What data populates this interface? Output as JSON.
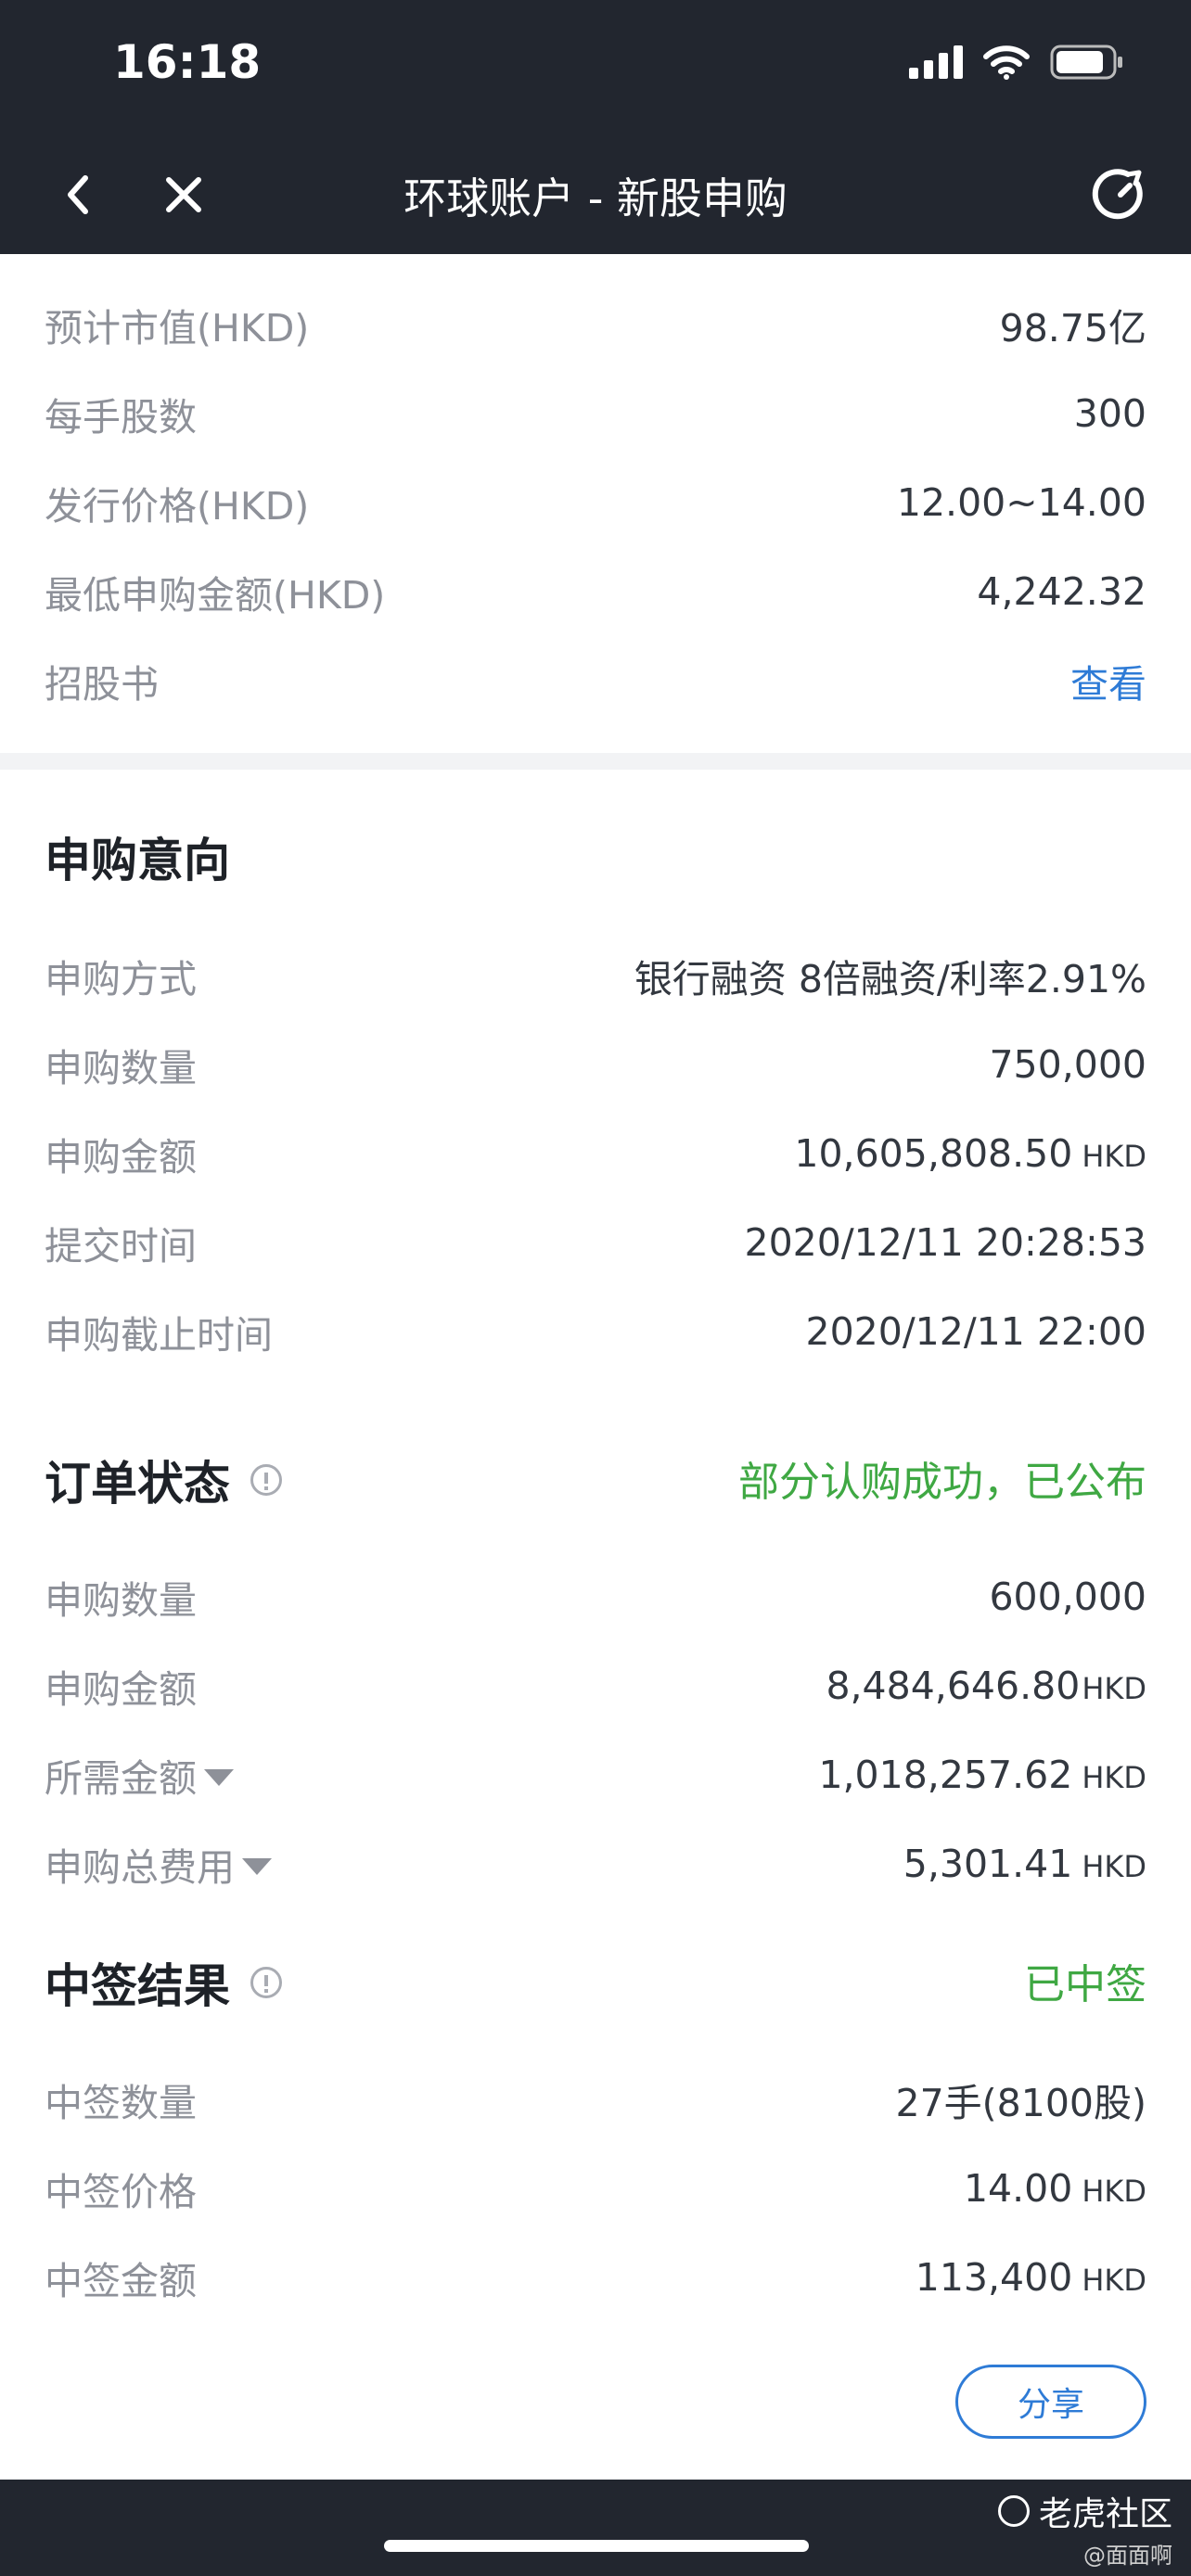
{
  "status_bar": {
    "time": "16:18"
  },
  "nav": {
    "title": "环球账户 - 新股申购"
  },
  "stock_info": [
    {
      "label": "预计市值(HKD)",
      "value": "98.75亿"
    },
    {
      "label": "每手股数",
      "value": "300"
    },
    {
      "label": "发行价格(HKD)",
      "value": "12.00~14.00"
    },
    {
      "label": "最低申购金额(HKD)",
      "value": "4,242.32"
    }
  ],
  "prospectus": {
    "label": "招股书",
    "link": "查看"
  },
  "intent": {
    "title": "申购意向",
    "rows": [
      {
        "label": "申购方式",
        "value": "银行融资 8倍融资/利率2.91%",
        "unit": ""
      },
      {
        "label": "申购数量",
        "value": "750,000",
        "unit": ""
      },
      {
        "label": "申购金额",
        "value": "10,605,808.50",
        "unit": "HKD"
      },
      {
        "label": "提交时间",
        "value": "2020/12/11 20:28:53",
        "unit": ""
      },
      {
        "label": "申购截止时间",
        "value": "2020/12/11 22:00",
        "unit": ""
      }
    ]
  },
  "order": {
    "title": "订单状态",
    "status": "部分认购成功，已公布",
    "rows": [
      {
        "label": "申购数量",
        "value": "600,000",
        "unit": ""
      },
      {
        "label": "申购金额",
        "value": "8,484,646.80",
        "unit": "HKD"
      },
      {
        "label": "所需金额",
        "value": "1,018,257.62",
        "unit": "HKD"
      },
      {
        "label": "申购总费用",
        "value": "5,301.41",
        "unit": "HKD"
      }
    ]
  },
  "result": {
    "title": "中签结果",
    "status": "已中签",
    "rows": [
      {
        "label": "中签数量",
        "value": "27手(8100股)",
        "unit": ""
      },
      {
        "label": "中签价格",
        "value": "14.00",
        "unit": "HKD"
      },
      {
        "label": "中签金额",
        "value": "113,400",
        "unit": "HKD"
      }
    ]
  },
  "share_button": "分享",
  "watermark": {
    "brand": "老虎社区",
    "user": "@面面啊"
  },
  "colors": {
    "dark_bar": "#22262f",
    "link_blue": "#2e7bd6",
    "success_green": "#3fa843"
  }
}
